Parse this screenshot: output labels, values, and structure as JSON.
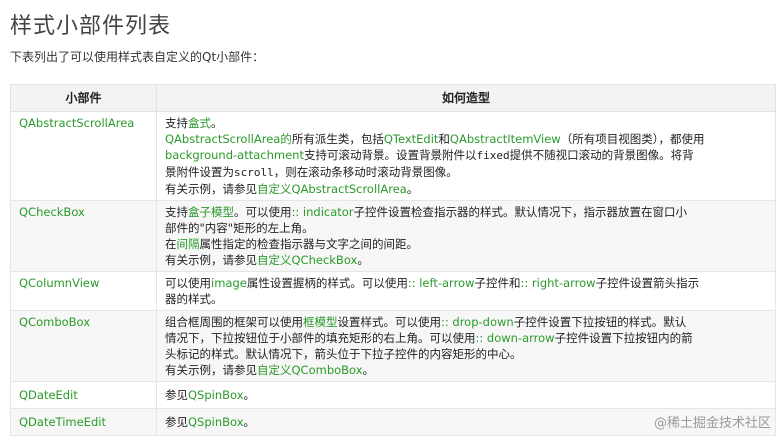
{
  "page": {
    "title": "样式小部件列表",
    "intro": "下表列出了可以使用样式表自定义的Qt小部件："
  },
  "table": {
    "headers": [
      "小部件",
      "如何造型"
    ],
    "rows": {
      "r0": {
        "widget": "QAbstractScrollArea",
        "l1a": "支持",
        "l1b": "盒式",
        "l1c": "。",
        "l2a": "QAbstractScrollArea的",
        "l2b": "所有派生类，包括",
        "l2c": "QTextEdit",
        "l2d": "和",
        "l2e": "QAbstractItemView",
        "l2f": "（所有项目视图类），都使用",
        "l3a": "background-attachment",
        "l3b": "支持可滚动背景。设置背景附件以",
        "l3c": "fixed",
        "l3d": "提供不随视口滚动的背景图像。将背",
        "l4a": "景附件设置为",
        "l4b": "scroll",
        "l4c": "，则在滚动条移动时滚动背景图像。",
        "l5a": "有关示例，请参见",
        "l5b": "自定义QAbstractScrollArea",
        "l5c": "。"
      },
      "r1": {
        "widget": "QCheckBox",
        "l1a": "支持",
        "l1b": "盒子模型",
        "l1c": "。可以使用",
        "l1d": ":: indicator",
        "l1e": "子控件设置检查指示器的样式。默认情况下，指示器放置在窗口小",
        "l2a": "部件的\"内容\"矩形的左上角。",
        "l3a": "在",
        "l3b": "间隔",
        "l3c": "属性指定的检查指示器与文字之间的间距。",
        "l4a": "有关示例，请参见",
        "l4b": "自定义QCheckBox",
        "l4c": "。"
      },
      "r2": {
        "widget": "QColumnView",
        "l1a": "可以使用",
        "l1b": "image",
        "l1c": "属性设置握柄的样式。可以使用",
        "l1d": ":: left-arrow",
        "l1e": "子控件和",
        "l1f": ":: right-arrow",
        "l1g": "子控件设置箭头指示",
        "l2a": "器的样式。"
      },
      "r3": {
        "widget": "QComboBox",
        "l1a": "组合框周围的框架可以使用",
        "l1b": "框模型",
        "l1c": "设置样式。可以使用",
        "l1d": ":: drop-down",
        "l1e": "子控件设置下拉按钮的样式。默认",
        "l2a": "情况下，下拉按钮位于小部件的填充矩形的右上角。可以使用",
        "l2b": ":: down-arrow",
        "l2c": "子控件设置下拉按钮内的箭",
        "l3a": "头标记的样式。默认情况下，箭头位于下拉子控件的内容矩形的中心。",
        "l4a": "有关示例，请参见",
        "l4b": "自定义QComboBox",
        "l4c": "。"
      },
      "r4": {
        "widget": "QDateEdit",
        "l1a": "参见",
        "l1b": "QSpinBox",
        "l1c": "。"
      },
      "r5": {
        "widget": "QDateTimeEdit",
        "l1a": "参见",
        "l1b": "QSpinBox",
        "l1c": "。"
      }
    }
  },
  "watermark": {
    "text": "@稀土掘金技术社区",
    "icon": "at-sign-icon"
  },
  "colors": {
    "link": "#2a9a2a",
    "header_bg": "#f3f3f3",
    "alt_row_bg": "#f7f7f7"
  }
}
